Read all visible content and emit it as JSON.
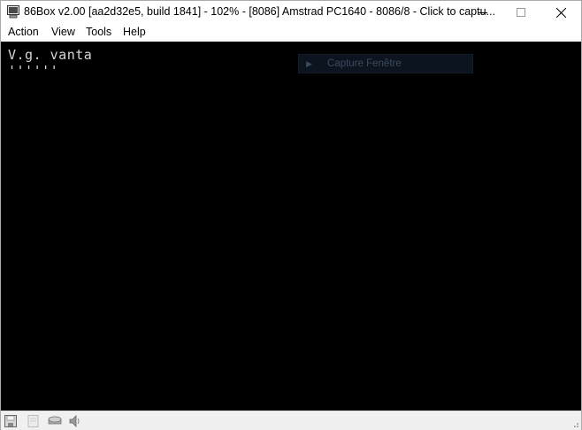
{
  "window": {
    "title": "86Box v2.00 [aa2d32e5, build 1841] - 102% - [8086] Amstrad PC1640 - 8086/8 - Click to captu...",
    "controls": {
      "minimize": "minimize",
      "maximize": "maximize",
      "close": "close"
    }
  },
  "menu": {
    "items": [
      "Action",
      "View",
      "Tools",
      "Help"
    ]
  },
  "screen": {
    "lines": [
      "V.g. vanta",
      "''''''"
    ],
    "overlay_text": "Capture Fenêtre"
  },
  "statusbar": {
    "icons": [
      "floppy-drive-icon",
      "floppy-drive-empty-icon",
      "hard-disk-icon",
      "speaker-icon"
    ]
  },
  "colors": {
    "screen_bg": "#000000",
    "terminal_text": "#d8d8d8",
    "chrome_bg": "#ffffff",
    "statusbar_bg": "#f0f0f0"
  }
}
